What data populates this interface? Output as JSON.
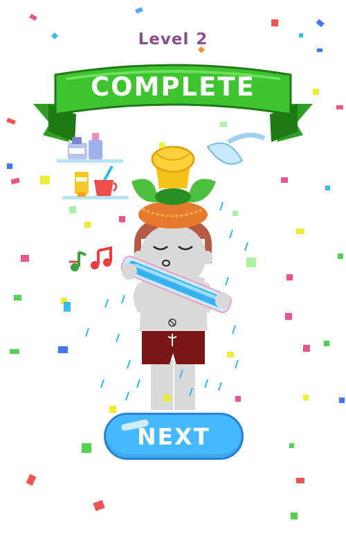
{
  "level": {
    "label": "Level",
    "number": "2"
  },
  "banner": {
    "text": "COMPLETE",
    "color": "#3dc42e"
  },
  "next_button": {
    "label": "NEXT",
    "color": "#45b8ff"
  },
  "colors": {
    "title": "#8a4f87",
    "character_skin": "#d9d9d9",
    "shorts": "#7c1515",
    "hair": "#b55a44"
  },
  "icons": [
    "music-notes-icon",
    "shower-head-icon",
    "toothbrush-cup-icon",
    "toothpaste-icon",
    "lotion-bottles-icon",
    "flute-icon",
    "hat-icon",
    "confetti"
  ]
}
